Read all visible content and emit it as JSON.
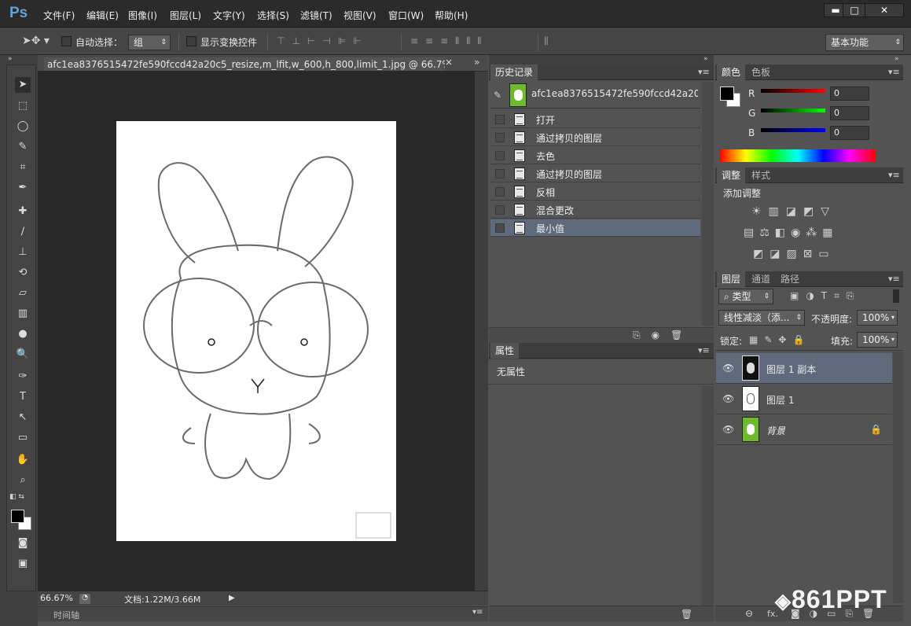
{
  "app": {
    "logo": "Ps"
  },
  "menu": [
    "文件(F)",
    "编辑(E)",
    "图像(I)",
    "图层(L)",
    "文字(Y)",
    "选择(S)",
    "滤镜(T)",
    "视图(V)",
    "窗口(W)",
    "帮助(H)"
  ],
  "window_controls": {
    "minimize": "▬",
    "maximize": "□",
    "close": "✕"
  },
  "options": {
    "auto_select_label": "自动选择：",
    "auto_select_value": "组",
    "show_transform_label": "显示变换控件",
    "workspace": "基本功能"
  },
  "document": {
    "tab_title": "afc1ea8376515472fe590fccd42a20c5_resize,m_lfit,w_600,h_800,limit_1.jpg @ 66.7% (图层 1...",
    "close": "×",
    "zoom": "66.67%",
    "doc_size": "文档:1.22M/3.66M",
    "timeline_label": "时间轴"
  },
  "history": {
    "tab": "历史记录",
    "snapshot": "afc1ea8376515472fe590fccd42a20c5_r...",
    "items": [
      "打开",
      "通过拷贝的图层",
      "去色",
      "通过拷贝的图层",
      "反相",
      "混合更改",
      "最小值"
    ],
    "selected_index": 6
  },
  "properties": {
    "tab": "属性",
    "empty": "无属性"
  },
  "color": {
    "tabs": [
      "颜色",
      "色板"
    ],
    "r_label": "R",
    "g_label": "G",
    "b_label": "B",
    "r": "0",
    "g": "0",
    "b": "0"
  },
  "adjustments": {
    "tabs": [
      "调整",
      "样式"
    ],
    "title": "添加调整"
  },
  "layers": {
    "tabs": [
      "图层",
      "通道",
      "路径"
    ],
    "filter_kind": "类型",
    "blend_mode": "线性减淡（添...",
    "opacity_label": "不透明度:",
    "opacity": "100%",
    "lock_label": "锁定:",
    "fill_label": "填充:",
    "fill": "100%",
    "items": [
      {
        "name": "图层 1 副本",
        "selected": true
      },
      {
        "name": "图层 1",
        "selected": false
      },
      {
        "name": "背景",
        "selected": false
      }
    ],
    "footer_fx": "fx."
  },
  "watermark": "861PPT",
  "colors": {
    "accent": "#5fa2dd",
    "selection": "#5f6b7d",
    "thumb_green": "#6dbb2c"
  }
}
